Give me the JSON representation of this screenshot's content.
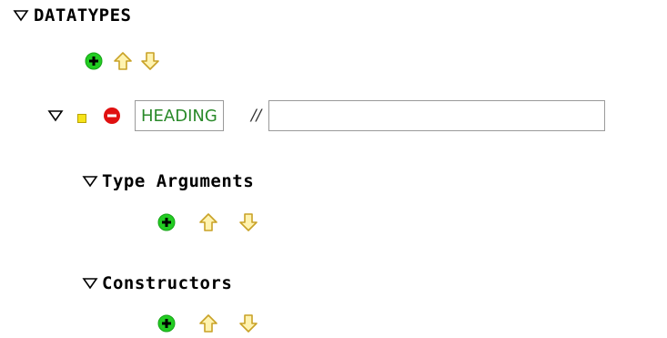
{
  "datatypes": {
    "title": "DATATYPES",
    "icons": [
      "triangle-down-icon",
      "add-icon",
      "up-arrow-icon",
      "down-arrow-icon"
    ]
  },
  "datatype": {
    "name_value": "HEADING",
    "comment_separator": "//",
    "comment_value": "",
    "icons": [
      "triangle-down-icon",
      "yellow-square-icon",
      "remove-icon"
    ]
  },
  "type_arguments": {
    "title": "Type Arguments"
  },
  "constructors": {
    "title": "Constructors"
  },
  "colors": {
    "add_green": "#22cc22",
    "remove_red": "#e01010",
    "arrow_fill": "#fff3b0",
    "arrow_stroke": "#c9a227",
    "marker_yellow": "#f6e31a",
    "name_text": "#2a8a2a"
  }
}
